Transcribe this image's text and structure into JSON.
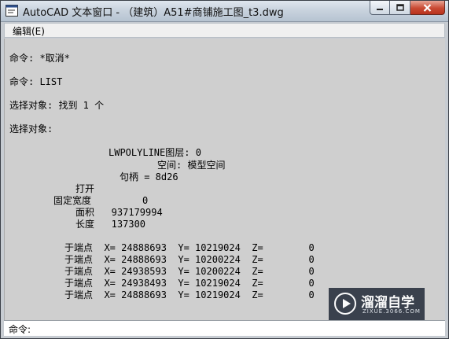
{
  "window": {
    "title": "AutoCAD 文本窗口 - （建筑）A51#商铺施工图_t3.dwg"
  },
  "menu": {
    "items": [
      {
        "label": "编辑(E)"
      }
    ]
  },
  "text_lines": [
    "命令: *取消*",
    "命令: LIST",
    "选择对象: 找到 1 个",
    "选择对象:",
    "LWPOLYLINE图层: 0",
    "空间: 模型空间",
    "句柄 = 8d26",
    "打开",
    "固定宽度         0",
    "面积   937179994",
    "长度   137300",
    "于端点  X= 24888693  Y= 10219024  Z=        0",
    "于端点  X= 24888693  Y= 10200224  Z=        0",
    "于端点  X= 24938593  Y= 10200224  Z=        0",
    "于端点  X= 24938493  Y= 10219024  Z=        0",
    "于端点  X= 24888693  Y= 10219024  Z=        0"
  ],
  "command_line": {
    "prompt": "命令:"
  },
  "watermark": {
    "title": "溜溜自学",
    "subtitle": "ZIXUE.3066.COM"
  }
}
